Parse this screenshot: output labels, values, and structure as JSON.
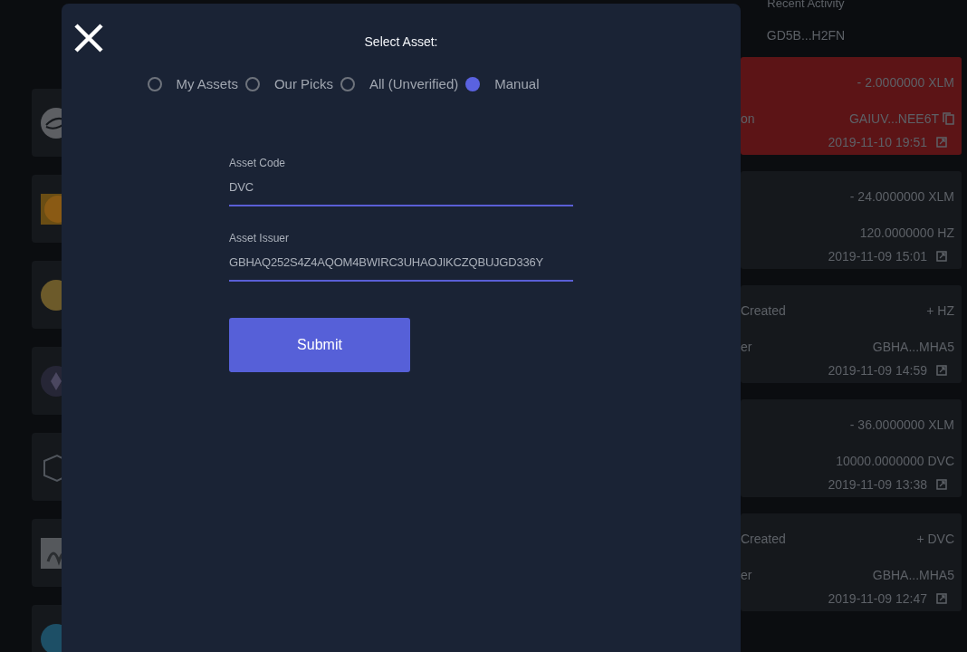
{
  "activity": {
    "title": "Recent Activity",
    "account": "GD5B...H2FN",
    "items": [
      {
        "highlighted": true,
        "rows": [
          {
            "kind": "amount",
            "right": "- 2.0000000 XLM"
          },
          {
            "kind": "copy",
            "left": "on",
            "right": "GAIUV...NEE6T"
          },
          {
            "kind": "date",
            "right": "2019-11-10 19:51"
          }
        ]
      },
      {
        "highlighted": false,
        "rows": [
          {
            "kind": "amount",
            "right": "- 24.0000000 XLM"
          },
          {
            "kind": "value",
            "right": "120.0000000 HZ"
          },
          {
            "kind": "date",
            "right": "2019-11-09 15:01"
          }
        ]
      },
      {
        "highlighted": false,
        "rows": [
          {
            "kind": "amount",
            "left": "Created",
            "right": "+ HZ"
          },
          {
            "kind": "value",
            "left": "er",
            "right": "GBHA...MHA5"
          },
          {
            "kind": "date",
            "right": "2019-11-09 14:59"
          }
        ]
      },
      {
        "highlighted": false,
        "rows": [
          {
            "kind": "amount",
            "right": "- 36.0000000 XLM"
          },
          {
            "kind": "value",
            "right": "10000.0000000 DVC"
          },
          {
            "kind": "date",
            "right": "2019-11-09 13:38"
          }
        ]
      },
      {
        "highlighted": false,
        "rows": [
          {
            "kind": "amount",
            "left": "Created",
            "right": "+ DVC"
          },
          {
            "kind": "value",
            "left": "er",
            "right": "GBHA...MHA5"
          },
          {
            "kind": "date",
            "right": "2019-11-09 12:47"
          }
        ]
      }
    ]
  },
  "dialog": {
    "title": "Select Asset:",
    "options": [
      {
        "label": "My Assets",
        "selected": false
      },
      {
        "label": "Our Picks",
        "selected": false
      },
      {
        "label": "All (Unverified)",
        "selected": false
      },
      {
        "label": "Manual",
        "selected": true
      }
    ],
    "fields": [
      {
        "label": "Asset Code",
        "value": "DVC"
      },
      {
        "label": "Asset Issuer",
        "value": "GBHAQ252S4Z4AQOM4BWIRC3UHAOJIKCZQBUJGD336Y"
      }
    ],
    "submit": "Submit"
  }
}
